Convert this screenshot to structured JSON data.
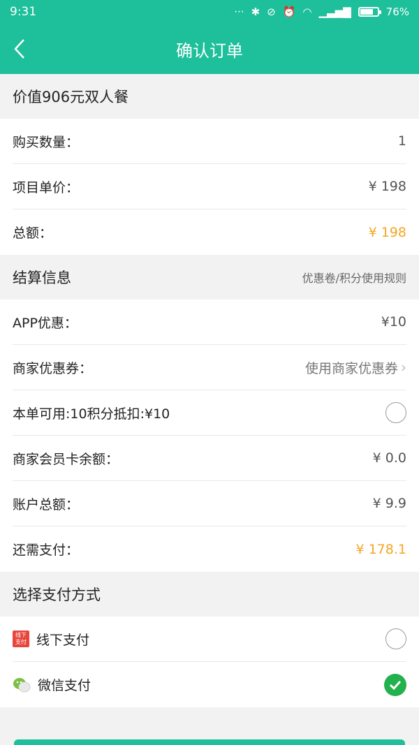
{
  "status": {
    "time": "9:31",
    "battery": "76%",
    "battery_level": 0.76
  },
  "header": {
    "title": "确认订单"
  },
  "product": {
    "name": "价值906元双人餐"
  },
  "order": {
    "quantity_label": "购买数量：",
    "quantity": "1",
    "price_label": "项目单价：",
    "price": "¥ 198",
    "total_label": "总额：",
    "total": "¥ 198"
  },
  "settlement": {
    "title": "结算信息",
    "rules_link": "优惠卷/积分使用规则",
    "app_discount_label": "APP优惠：",
    "app_discount": "¥10",
    "coupon_label": "商家优惠券：",
    "coupon_action": "使用商家优惠券",
    "points_label": "本单可用:10积分抵扣:¥10",
    "member_card_label": "商家会员卡余额：",
    "member_card": "¥ 0.0",
    "account_label": "账户总额：",
    "account": "¥ 9.9",
    "due_label": "还需支付：",
    "due": "¥ 178.1"
  },
  "payment": {
    "title": "选择支付方式",
    "methods": [
      {
        "label": "线下支付",
        "icon_text": "线下支付",
        "selected": false
      },
      {
        "label": "微信支付",
        "selected": true
      }
    ]
  },
  "colors": {
    "accent": "#1ebf9b",
    "orange": "#f5a623",
    "check": "#22b14c"
  }
}
